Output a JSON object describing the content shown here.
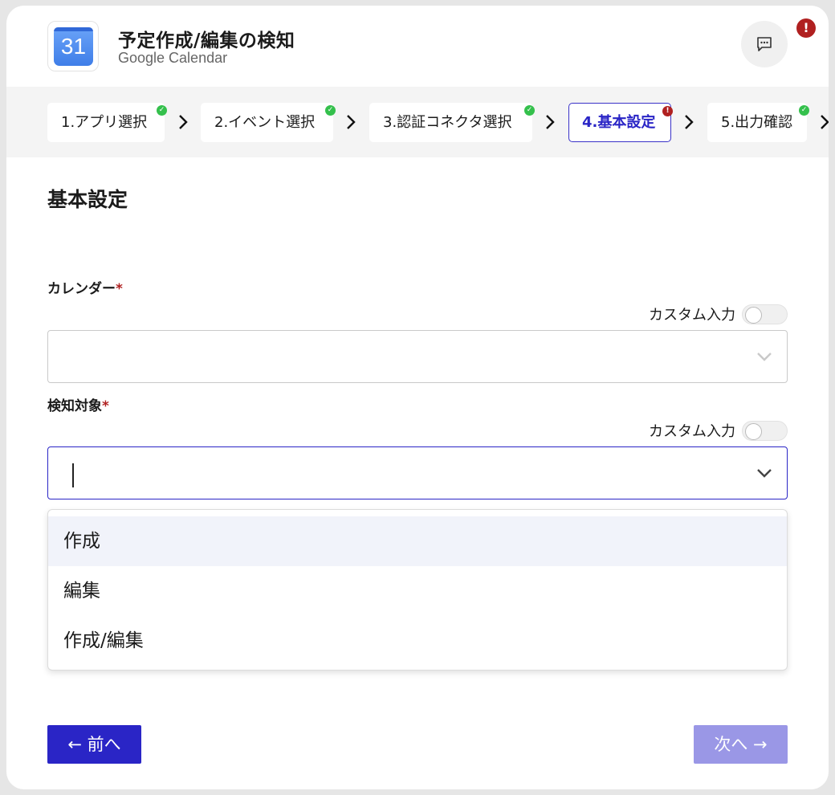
{
  "header": {
    "app_icon_text": "31",
    "title": "予定作成/編集の検知",
    "subtitle": "Google Calendar",
    "alert_badge": "!"
  },
  "steps": [
    {
      "label": "1.アプリ選択",
      "status": "ok"
    },
    {
      "label": "2.イベント選択",
      "status": "ok"
    },
    {
      "label": "3.認証コネクタ選択",
      "status": "ok"
    },
    {
      "label": "4.基本設定",
      "status": "error",
      "active": true
    },
    {
      "label": "5.出力確認",
      "status": "ok"
    }
  ],
  "main": {
    "section_title": "基本設定",
    "fields": [
      {
        "label": "カレンダー",
        "required_mark": "*",
        "custom_input_label": "カスタム入力",
        "custom_input_on": false,
        "value": ""
      },
      {
        "label": "検知対象",
        "required_mark": "*",
        "custom_input_label": "カスタム入力",
        "custom_input_on": false,
        "value": ""
      }
    ],
    "dropdown_options": [
      "作成",
      "編集",
      "作成/編集"
    ],
    "highlighted_option": 0
  },
  "footer": {
    "prev_label": "← 前へ",
    "next_label": "次へ →"
  },
  "colors": {
    "accent": "#2a25c6",
    "accent_disabled": "#9a97e6",
    "error": "#b02020",
    "success": "#34c04c"
  }
}
